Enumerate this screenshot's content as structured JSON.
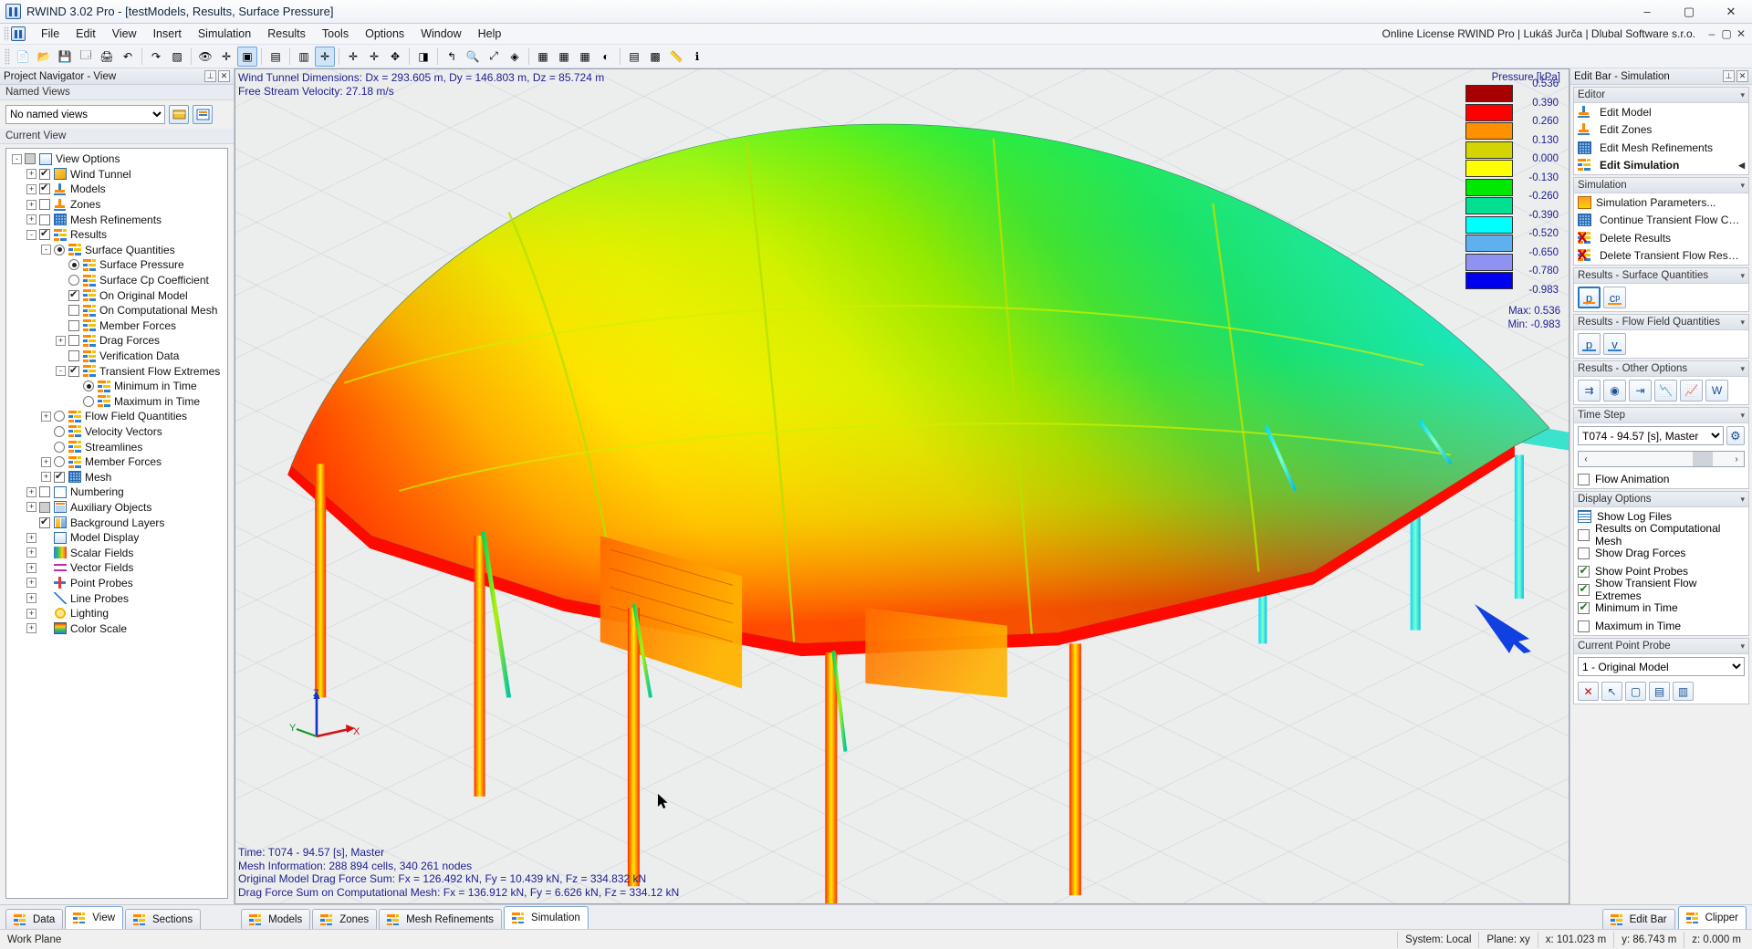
{
  "window": {
    "title": "RWIND 3.02 Pro - [testModels, Results, Surface Pressure]",
    "minimize": "–",
    "maximize": "▢",
    "close": "✕"
  },
  "menu": {
    "items": [
      "File",
      "Edit",
      "View",
      "Insert",
      "Simulation",
      "Results",
      "Tools",
      "Options",
      "Window",
      "Help"
    ],
    "license": "Online License RWIND Pro | Lukáš Jurča | Dlubal Software s.r.o.",
    "doc_minimize": "–",
    "doc_restore": "▢",
    "doc_close": "✕"
  },
  "toolbar": {
    "buttons": [
      {
        "name": "new-file",
        "glyph": "📄"
      },
      {
        "name": "open-file",
        "glyph": "📂"
      },
      {
        "name": "save-file",
        "glyph": "💾"
      },
      {
        "name": "save-as",
        "glyph": "🗔"
      },
      {
        "name": "print",
        "glyph": "🖨"
      },
      {
        "name": "undo",
        "glyph": "↶"
      },
      {
        "name": "redo",
        "glyph": "↷"
      },
      {
        "name": "render-shaded",
        "glyph": "▨"
      },
      {
        "name": "render-wire",
        "glyph": "👁"
      },
      {
        "name": "snap-grid",
        "glyph": "✛"
      },
      {
        "name": "select-window",
        "glyph": "▣"
      },
      {
        "name": "select-model",
        "glyph": "▤"
      },
      {
        "name": "deselect",
        "glyph": "▥"
      },
      {
        "name": "rotate-view",
        "glyph": "✛"
      },
      {
        "name": "rotate-view-2",
        "glyph": "✛"
      },
      {
        "name": "rotate-view-3",
        "glyph": "✛"
      },
      {
        "name": "pan-view",
        "glyph": "✥"
      },
      {
        "name": "view-render",
        "glyph": "◨"
      },
      {
        "name": "zoom-previous",
        "glyph": "↰"
      },
      {
        "name": "zoom-window",
        "glyph": "🔍"
      },
      {
        "name": "zoom-all",
        "glyph": "⤢"
      },
      {
        "name": "view-iso",
        "glyph": "◈"
      },
      {
        "name": "view-xy",
        "glyph": "▦"
      },
      {
        "name": "view-xz",
        "glyph": "▦"
      },
      {
        "name": "view-yz",
        "glyph": "▦"
      },
      {
        "name": "visibility",
        "glyph": "◐"
      },
      {
        "name": "layers",
        "glyph": "▤"
      },
      {
        "name": "grid-toggle",
        "glyph": "▩"
      },
      {
        "name": "measure",
        "glyph": "📏"
      },
      {
        "name": "info",
        "glyph": "ℹ"
      }
    ]
  },
  "navigator": {
    "title": "Project Navigator - View",
    "pin": "⊥",
    "close": "✕",
    "named_views_header": "Named Views",
    "named_views_value": "No named views",
    "named_view_btn_1": "save-view-icon",
    "named_view_btn_2": "manage-views-icon",
    "current_view_header": "Current View",
    "tree": [
      {
        "label": "View Options",
        "indent": 0,
        "tog": "-",
        "ctrl": "cb-gray",
        "icon": "ic-disp"
      },
      {
        "label": "Wind Tunnel",
        "indent": 1,
        "tog": "+",
        "ctrl": "cb-on",
        "icon": "ic-tunnel"
      },
      {
        "label": "Models",
        "indent": 1,
        "tog": "+",
        "ctrl": "cb-on",
        "icon": "ic-model"
      },
      {
        "label": "Zones",
        "indent": 1,
        "tog": "+",
        "ctrl": "cb-off",
        "icon": "ic-zone"
      },
      {
        "label": "Mesh Refinements",
        "indent": 1,
        "tog": "+",
        "ctrl": "cb-off",
        "icon": "ic-mesh"
      },
      {
        "label": "Results",
        "indent": 1,
        "tog": "-",
        "ctrl": "cb-on",
        "icon": "ic-res"
      },
      {
        "label": "Surface Quantities",
        "indent": 2,
        "tog": "-",
        "ctrl": "rb-on",
        "icon": "ic-res"
      },
      {
        "label": "Surface Pressure",
        "indent": 3,
        "tog": "",
        "ctrl": "rb-on",
        "icon": "ic-res"
      },
      {
        "label": "Surface Cp Coefficient",
        "indent": 3,
        "tog": "",
        "ctrl": "rb-off",
        "icon": "ic-res"
      },
      {
        "label": "On Original Model",
        "indent": 3,
        "tog": "",
        "ctrl": "cb-on",
        "icon": "ic-res"
      },
      {
        "label": "On Computational Mesh",
        "indent": 3,
        "tog": "",
        "ctrl": "cb-off",
        "icon": "ic-res"
      },
      {
        "label": "Member Forces",
        "indent": 3,
        "tog": "",
        "ctrl": "cb-off",
        "icon": "ic-res"
      },
      {
        "label": "Drag Forces",
        "indent": 3,
        "tog": "+",
        "ctrl": "cb-off",
        "icon": "ic-res"
      },
      {
        "label": "Verification Data",
        "indent": 3,
        "tog": "",
        "ctrl": "cb-off",
        "icon": "ic-res"
      },
      {
        "label": "Transient Flow Extremes",
        "indent": 3,
        "tog": "-",
        "ctrl": "cb-on",
        "icon": "ic-res"
      },
      {
        "label": "Minimum in Time",
        "indent": 4,
        "tog": "",
        "ctrl": "rb-on",
        "icon": "ic-res"
      },
      {
        "label": "Maximum in Time",
        "indent": 4,
        "tog": "",
        "ctrl": "rb-off",
        "icon": "ic-res"
      },
      {
        "label": "Flow Field Quantities",
        "indent": 2,
        "tog": "+",
        "ctrl": "rb-off",
        "icon": "ic-res"
      },
      {
        "label": "Velocity Vectors",
        "indent": 2,
        "tog": "",
        "ctrl": "rb-off",
        "icon": "ic-res"
      },
      {
        "label": "Streamlines",
        "indent": 2,
        "tog": "",
        "ctrl": "rb-off",
        "icon": "ic-res"
      },
      {
        "label": "Member Forces",
        "indent": 2,
        "tog": "+",
        "ctrl": "rb-off",
        "icon": "ic-res"
      },
      {
        "label": "Mesh",
        "indent": 2,
        "tog": "+",
        "ctrl": "cb-on",
        "icon": "ic-mesh"
      },
      {
        "label": "Numbering",
        "indent": 1,
        "tog": "+",
        "ctrl": "cb-off",
        "icon": "ic-num"
      },
      {
        "label": "Auxiliary Objects",
        "indent": 1,
        "tog": "+",
        "ctrl": "cb-gray",
        "icon": "ic-aux"
      },
      {
        "label": "Background Layers",
        "indent": 1,
        "tog": "",
        "ctrl": "cb-on",
        "icon": "ic-bg"
      },
      {
        "label": "Model Display",
        "indent": 1,
        "tog": "+",
        "ctrl": "none",
        "icon": "ic-disp"
      },
      {
        "label": "Scalar Fields",
        "indent": 1,
        "tog": "+",
        "ctrl": "none",
        "icon": "ic-scalar"
      },
      {
        "label": "Vector Fields",
        "indent": 1,
        "tog": "+",
        "ctrl": "none",
        "icon": "ic-vector"
      },
      {
        "label": "Point Probes",
        "indent": 1,
        "tog": "+",
        "ctrl": "none",
        "icon": "ic-probe"
      },
      {
        "label": "Line Probes",
        "indent": 1,
        "tog": "+",
        "ctrl": "none",
        "icon": "ic-line"
      },
      {
        "label": "Lighting",
        "indent": 1,
        "tog": "+",
        "ctrl": "none",
        "icon": "ic-light"
      },
      {
        "label": "Color Scale",
        "indent": 1,
        "tog": "+",
        "ctrl": "none",
        "icon": "ic-colorscale"
      }
    ]
  },
  "viewport": {
    "info_top": "Wind Tunnel Dimensions: Dx = 293.605 m, Dy = 146.803 m, Dz = 85.724 m\nFree Stream Velocity: 27.18 m/s",
    "info_bottom": "Time: T074 - 94.57 [s], Master\nMesh Information: 288 894 cells, 340 261 nodes\nOriginal Model Drag Force Sum: Fx = 126.492 kN, Fy = 10.439 kN, Fz = 334.832 kN\nDrag Force Sum on Computational Mesh: Fx = 136.912 kN, Fy = 6.626 kN, Fz = 334.12 kN",
    "axes": {
      "x": "X",
      "y": "Y",
      "z": "Z"
    }
  },
  "chart_data": {
    "type": "heatmap",
    "title": "Pressure [kPa]",
    "legend_position": "top-right",
    "max_label": "Max:",
    "max_value": "0.536",
    "min_label": "Min:",
    "min_value": "-0.983",
    "tick_labels": [
      "0.536",
      "0.390",
      "0.260",
      "0.130",
      "0.000",
      "-0.130",
      "-0.260",
      "-0.390",
      "-0.520",
      "-0.650",
      "-0.780",
      "-0.983"
    ],
    "bands": [
      {
        "color": "#a80000",
        "upper": "0.536",
        "lower": "0.390"
      },
      {
        "color": "#fd0000",
        "upper": "0.390",
        "lower": "0.260"
      },
      {
        "color": "#ff9000",
        "upper": "0.260",
        "lower": "0.130"
      },
      {
        "color": "#d4d400",
        "upper": "0.130",
        "lower": "0.000"
      },
      {
        "color": "#ffff00",
        "upper": "0.000",
        "lower": "-0.130"
      },
      {
        "color": "#00e800",
        "upper": "-0.130",
        "lower": "-0.260"
      },
      {
        "color": "#00e090",
        "upper": "-0.260",
        "lower": "-0.390"
      },
      {
        "color": "#00ffff",
        "upper": "-0.390",
        "lower": "-0.520"
      },
      {
        "color": "#5fb0ef",
        "upper": "-0.520",
        "lower": "-0.650"
      },
      {
        "color": "#8f92f0",
        "upper": "-0.650",
        "lower": "-0.780"
      },
      {
        "color": "#0000f0",
        "upper": "-0.780",
        "lower": "-0.983"
      }
    ]
  },
  "editbar": {
    "title": "Edit Bar - Simulation",
    "pin": "⊥",
    "close": "✕",
    "editor": {
      "header": "Editor",
      "items": [
        {
          "label": "Edit Model",
          "icon": "edit-model-icon",
          "bold": false
        },
        {
          "label": "Edit Zones",
          "icon": "edit-zones-icon",
          "bold": false
        },
        {
          "label": "Edit Mesh Refinements",
          "icon": "edit-mesh-icon",
          "bold": false
        },
        {
          "label": "Edit Simulation",
          "icon": "edit-simulation-icon",
          "bold": true
        }
      ]
    },
    "simulation": {
      "header": "Simulation",
      "items": [
        {
          "label": "Simulation Parameters...",
          "icon": "simulation-parameters-icon"
        },
        {
          "label": "Continue Transient Flow Calculat...",
          "icon": "continue-transient-icon"
        },
        {
          "label": "Delete Results",
          "icon": "delete-results-icon"
        },
        {
          "label": "Delete Transient Flow Results...",
          "icon": "delete-transient-icon"
        }
      ]
    },
    "results_surface": {
      "header": "Results - Surface Quantities",
      "buttons": [
        {
          "label": "p",
          "name": "surface-pressure-button",
          "selected": true,
          "under": "#ff8a00"
        },
        {
          "label": "c",
          "sub": "p",
          "name": "surface-cp-button",
          "selected": false,
          "under": "#ff8a00"
        }
      ]
    },
    "results_flow": {
      "header": "Results - Flow Field Quantities",
      "buttons": [
        {
          "label": "p",
          "name": "flow-pressure-button",
          "selected": false,
          "under": "#2b7fd4"
        },
        {
          "label": "v",
          "name": "flow-velocity-button",
          "selected": false,
          "under": "#2b7fd4"
        }
      ]
    },
    "results_other": {
      "header": "Results - Other Options",
      "buttons": [
        {
          "name": "velocity-vectors-button",
          "glyph": "⇉"
        },
        {
          "name": "streamlines-button",
          "glyph": "◉"
        },
        {
          "name": "clipping-plane-button",
          "glyph": "⇥"
        },
        {
          "name": "result-diagram-button",
          "glyph": "📉"
        },
        {
          "name": "result-chart-button",
          "glyph": "📈"
        },
        {
          "name": "export-word-button",
          "glyph": "W"
        }
      ]
    },
    "time_step": {
      "header": "Time Step",
      "value": "T074 - 94.57 [s], Master",
      "settings_icon": "gear-icon",
      "prev": "‹",
      "next": "›"
    },
    "flow_animation": {
      "label": "Flow Animation",
      "checked": false
    },
    "display_options": {
      "header": "Display Options",
      "items": [
        {
          "label": "Show Log Files",
          "type": "icon",
          "icon": "log-file-icon"
        },
        {
          "label": "Results on Computational Mesh",
          "type": "check",
          "checked": false
        },
        {
          "label": "Show Drag Forces",
          "type": "check",
          "checked": false
        },
        {
          "label": "Show Point Probes",
          "type": "check",
          "checked": true
        },
        {
          "label": "Show Transient Flow Extremes",
          "type": "check",
          "checked": true
        },
        {
          "label": "Minimum in Time",
          "type": "check",
          "checked": true
        },
        {
          "label": "Maximum in Time",
          "type": "check",
          "checked": false
        }
      ]
    },
    "point_probe": {
      "header": "Current Point Probe",
      "value": "1 - Original Model",
      "buttons": [
        {
          "name": "delete-probe-button",
          "glyph": "✕",
          "color": "#cc0000"
        },
        {
          "name": "pick-probe-button",
          "glyph": "↖"
        },
        {
          "name": "new-probe-button",
          "glyph": "▢"
        },
        {
          "name": "probe-table-button",
          "glyph": "▤"
        },
        {
          "name": "probe-export-button",
          "glyph": "▥"
        }
      ]
    }
  },
  "bottom_tabs": {
    "left": [
      {
        "label": "Data",
        "name": "tab-data",
        "active": false
      },
      {
        "label": "View",
        "name": "tab-view",
        "active": true
      },
      {
        "label": "Sections",
        "name": "tab-sections",
        "active": false
      }
    ],
    "center": [
      {
        "label": "Models",
        "name": "tab-models",
        "active": false
      },
      {
        "label": "Zones",
        "name": "tab-zones",
        "active": false
      },
      {
        "label": "Mesh Refinements",
        "name": "tab-mesh-refinements",
        "active": false
      },
      {
        "label": "Simulation",
        "name": "tab-simulation",
        "active": true
      }
    ],
    "right": [
      {
        "label": "Edit Bar",
        "name": "tab-edit-bar",
        "active": false
      },
      {
        "label": "Clipper",
        "name": "tab-clipper",
        "active": true
      }
    ]
  },
  "statusbar": {
    "work_plane": "Work Plane",
    "system": "System: Local",
    "plane": "Plane: xy",
    "x": "x:  101.023 m",
    "y": "y:  86.743 m",
    "z": "z:  0.000 m"
  }
}
